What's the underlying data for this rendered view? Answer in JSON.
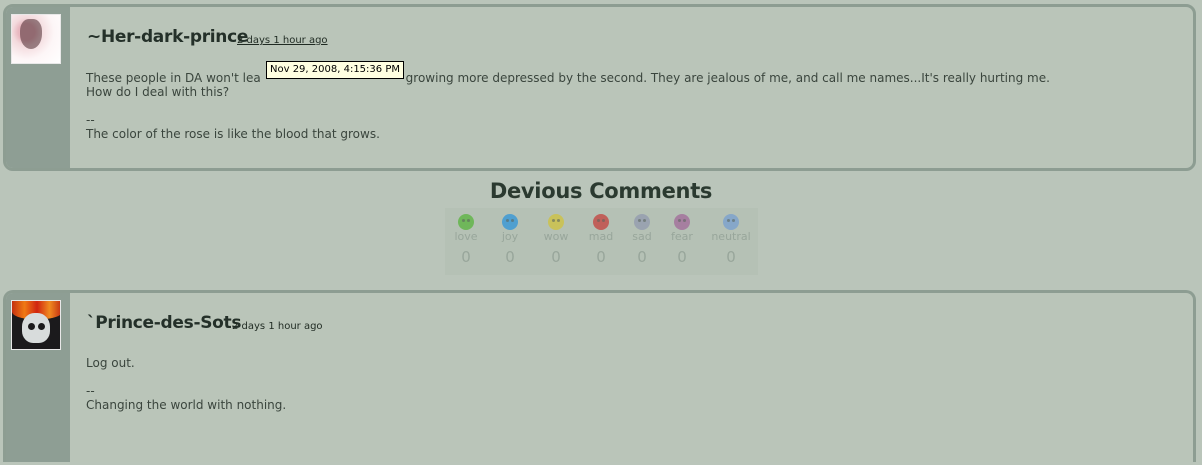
{
  "comments": [
    {
      "username": "~Her-dark-prince",
      "time": "2 days 1 hour ago",
      "tooltip": "Nov 29, 2008, 4:15:36 PM",
      "body": "These people in DA won't lea                                      growing more depressed by the second. They are jealous of me, and call me names...It's really hurting me.\nHow do I deal with this?\n\n--\nThe color of the rose is like the blood that grows."
    },
    {
      "username": "`Prince-des-Sots",
      "time": "2 days 1 hour ago",
      "body": "Log out.\n\n--\nChanging the world with nothing."
    }
  ],
  "section_title": "Devious Comments",
  "moods": [
    {
      "label": "love",
      "count": "0",
      "color": "#6fb75a"
    },
    {
      "label": "joy",
      "count": "0",
      "color": "#4f9fd0"
    },
    {
      "label": "wow",
      "count": "0",
      "color": "#c9c25a"
    },
    {
      "label": "mad",
      "count": "0",
      "color": "#c0605a"
    },
    {
      "label": "sad",
      "count": "0",
      "color": "#9aa3b0"
    },
    {
      "label": "fear",
      "count": "0",
      "color": "#a67fa0"
    },
    {
      "label": "neutral",
      "count": "0",
      "color": "#86a7c9"
    }
  ]
}
